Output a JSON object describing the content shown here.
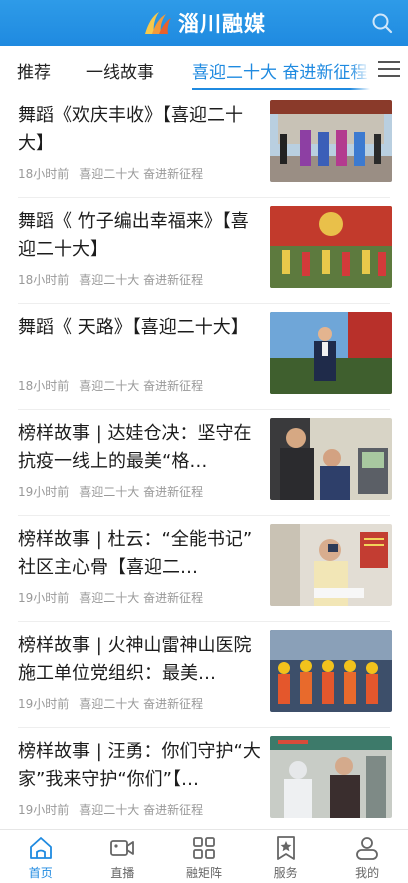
{
  "header": {
    "logo_text": "淄川融媒",
    "logo_icon": "wave-logo-icon",
    "search_icon": "search-icon",
    "brand_color": "#1f8ae0"
  },
  "tabs": [
    {
      "label": "推荐",
      "active": false
    },
    {
      "label": "一线故事",
      "active": false
    },
    {
      "label": "喜迎二十大 奋进新征程",
      "active": true
    }
  ],
  "tabs_menu_icon": "menu-icon",
  "feed": [
    {
      "title": "舞蹈《欢庆丰收》【喜迎二十大】",
      "time": "18小时前",
      "source": "喜迎二十大 奋进新征程",
      "thumb": "dance-harvest"
    },
    {
      "title": "舞蹈《 竹子编出幸福来》【喜迎二十大】",
      "time": "18小时前",
      "source": "喜迎二十大 奋进新征程",
      "thumb": "dance-bamboo"
    },
    {
      "title": "舞蹈《 天路》【喜迎二十大】",
      "time": "18小时前",
      "source": "喜迎二十大 奋进新征程",
      "thumb": "dance-tianlu"
    },
    {
      "title": "榜样故事 | 达娃仓决：坚守在抗疫一线上的最美“格…",
      "time": "19小时前",
      "source": "喜迎二十大 奋进新征程",
      "thumb": "story-dawa"
    },
    {
      "title": "榜样故事 | 杜云：“全能书记” 社区主心骨【喜迎二…",
      "time": "19小时前",
      "source": "喜迎二十大 奋进新征程",
      "thumb": "story-duyun"
    },
    {
      "title": "榜样故事 | 火神山雷神山医院施工单位党组织：最美…",
      "time": "19小时前",
      "source": "喜迎二十大 奋进新征程",
      "thumb": "story-hospital"
    },
    {
      "title": "榜样故事 | 汪勇：你们守护“大家”我来守护“你们”【…",
      "time": "19小时前",
      "source": "喜迎二十大 奋进新征程",
      "thumb": "story-wangyong"
    }
  ],
  "bottom_nav": [
    {
      "label": "首页",
      "icon": "home-icon",
      "active": true
    },
    {
      "label": "直播",
      "icon": "video-icon",
      "active": false
    },
    {
      "label": "融矩阵",
      "icon": "grid-icon",
      "active": false
    },
    {
      "label": "服务",
      "icon": "star-bookmark-icon",
      "active": false
    },
    {
      "label": "我的",
      "icon": "user-icon",
      "active": false
    }
  ]
}
